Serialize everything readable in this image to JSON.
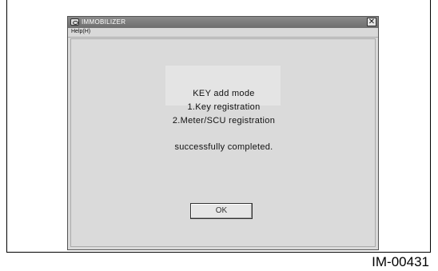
{
  "window": {
    "title": "IMMOBILIZER",
    "close_symbol": "✕",
    "icons": {
      "app": "car-app-icon",
      "close": "close-icon"
    }
  },
  "menu": {
    "help_label": "Help(H)"
  },
  "message": {
    "line1": "KEY add mode",
    "line2": "1.Key registration",
    "line3": "2.Meter/SCU registration",
    "line4": "successfully completed."
  },
  "buttons": {
    "ok_label": "OK"
  },
  "figure_id": "IM-00431",
  "colors": {
    "titlebar": "#7a7a7a",
    "window_bg": "#d9d9d9",
    "panel_bg": "#e4e4e4"
  }
}
